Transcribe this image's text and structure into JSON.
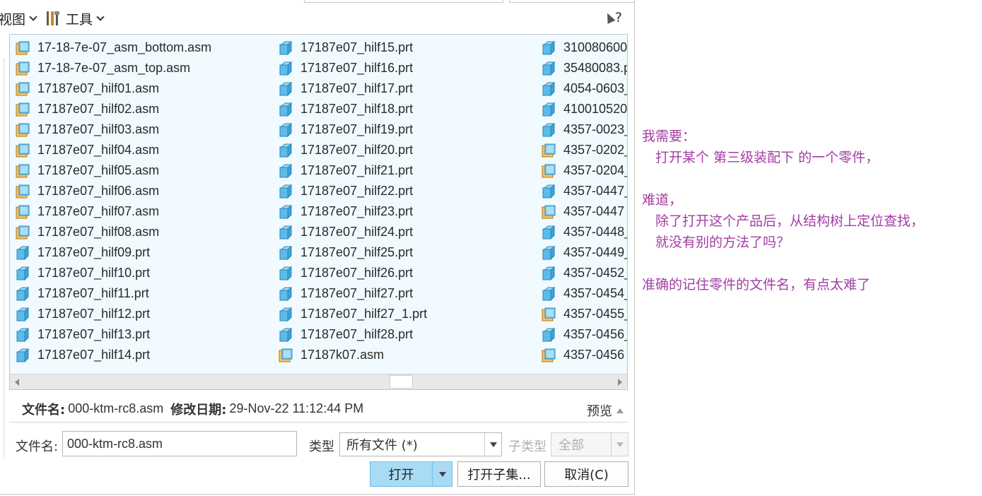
{
  "toolbar": {
    "view_label": "视图",
    "tools_label": "工具",
    "help_icon": "whats-this-help-icon"
  },
  "file_list": {
    "icons": {
      "asm": "assembly-icon",
      "prt": "part-icon"
    },
    "colors": {
      "panel_bg": "#f1fafe",
      "part_blue": "#5cbbe8",
      "asm_orange": "#e8a93a"
    },
    "columns": [
      [
        {
          "name": "17-18-7e-07_asm_bottom.asm",
          "type": "asm"
        },
        {
          "name": "17-18-7e-07_asm_top.asm",
          "type": "asm"
        },
        {
          "name": "17187e07_hilf01.asm",
          "type": "asm"
        },
        {
          "name": "17187e07_hilf02.asm",
          "type": "asm"
        },
        {
          "name": "17187e07_hilf03.asm",
          "type": "asm"
        },
        {
          "name": "17187e07_hilf04.asm",
          "type": "asm"
        },
        {
          "name": "17187e07_hilf05.asm",
          "type": "asm"
        },
        {
          "name": "17187e07_hilf06.asm",
          "type": "asm"
        },
        {
          "name": "17187e07_hilf07.asm",
          "type": "asm"
        },
        {
          "name": "17187e07_hilf08.asm",
          "type": "asm"
        },
        {
          "name": "17187e07_hilf09.prt",
          "type": "prt"
        },
        {
          "name": "17187e07_hilf10.prt",
          "type": "prt"
        },
        {
          "name": "17187e07_hilf11.prt",
          "type": "prt"
        },
        {
          "name": "17187e07_hilf12.prt",
          "type": "prt"
        },
        {
          "name": "17187e07_hilf13.prt",
          "type": "prt"
        },
        {
          "name": "17187e07_hilf14.prt",
          "type": "prt"
        }
      ],
      [
        {
          "name": "17187e07_hilf15.prt",
          "type": "prt"
        },
        {
          "name": "17187e07_hilf16.prt",
          "type": "prt"
        },
        {
          "name": "17187e07_hilf17.prt",
          "type": "prt"
        },
        {
          "name": "17187e07_hilf18.prt",
          "type": "prt"
        },
        {
          "name": "17187e07_hilf19.prt",
          "type": "prt"
        },
        {
          "name": "17187e07_hilf20.prt",
          "type": "prt"
        },
        {
          "name": "17187e07_hilf21.prt",
          "type": "prt"
        },
        {
          "name": "17187e07_hilf22.prt",
          "type": "prt"
        },
        {
          "name": "17187e07_hilf23.prt",
          "type": "prt"
        },
        {
          "name": "17187e07_hilf24.prt",
          "type": "prt"
        },
        {
          "name": "17187e07_hilf25.prt",
          "type": "prt"
        },
        {
          "name": "17187e07_hilf26.prt",
          "type": "prt"
        },
        {
          "name": "17187e07_hilf27.prt",
          "type": "prt"
        },
        {
          "name": "17187e07_hilf27_1.prt",
          "type": "prt"
        },
        {
          "name": "17187e07_hilf28.prt",
          "type": "prt"
        },
        {
          "name": "17187k07.asm",
          "type": "asm"
        }
      ],
      [
        {
          "name": "310080600",
          "type": "prt"
        },
        {
          "name": "35480083.p",
          "type": "prt"
        },
        {
          "name": "4054-0603_",
          "type": "prt"
        },
        {
          "name": "410010520",
          "type": "prt"
        },
        {
          "name": "4357-0023_",
          "type": "prt"
        },
        {
          "name": "4357-0202_",
          "type": "asm"
        },
        {
          "name": "4357-0204_",
          "type": "asm"
        },
        {
          "name": "4357-0447_",
          "type": "prt"
        },
        {
          "name": "4357-0447",
          "type": "asm"
        },
        {
          "name": "4357-0448_",
          "type": "prt"
        },
        {
          "name": "4357-0449_",
          "type": "prt"
        },
        {
          "name": "4357-0452_",
          "type": "prt"
        },
        {
          "name": "4357-0454_",
          "type": "prt"
        },
        {
          "name": "4357-0455_",
          "type": "asm"
        },
        {
          "name": "4357-0456_",
          "type": "prt"
        },
        {
          "name": "4357-0456",
          "type": "asm"
        }
      ]
    ]
  },
  "info_bar": {
    "filename_label": "文件名:",
    "filename_value": "000-ktm-rc8.asm",
    "modified_label": "修改日期:",
    "modified_value": "29-Nov-22 11:12:44 PM",
    "preview_label": "预览"
  },
  "form": {
    "filename_label": "文件名:",
    "filename_value": "000-ktm-rc8.asm",
    "type_label": "类型",
    "type_value": "所有文件 (*)",
    "subtype_label": "子类型",
    "subtype_value": "全部"
  },
  "buttons": {
    "open": "打开",
    "open_subset": "打开子集...",
    "cancel": "取消(C)",
    "open_color": "#a9dbf4"
  },
  "annotation": {
    "color": "#a43ca4",
    "lines": [
      "我需要：",
      "打开某个 第三级装配下 的一个零件，",
      "",
      "难道，",
      "除了打开这个产品后，从结构树上定位查找，",
      "就没有别的方法了吗？",
      "",
      "准确的记住零件的文件名，有点太难了"
    ]
  }
}
